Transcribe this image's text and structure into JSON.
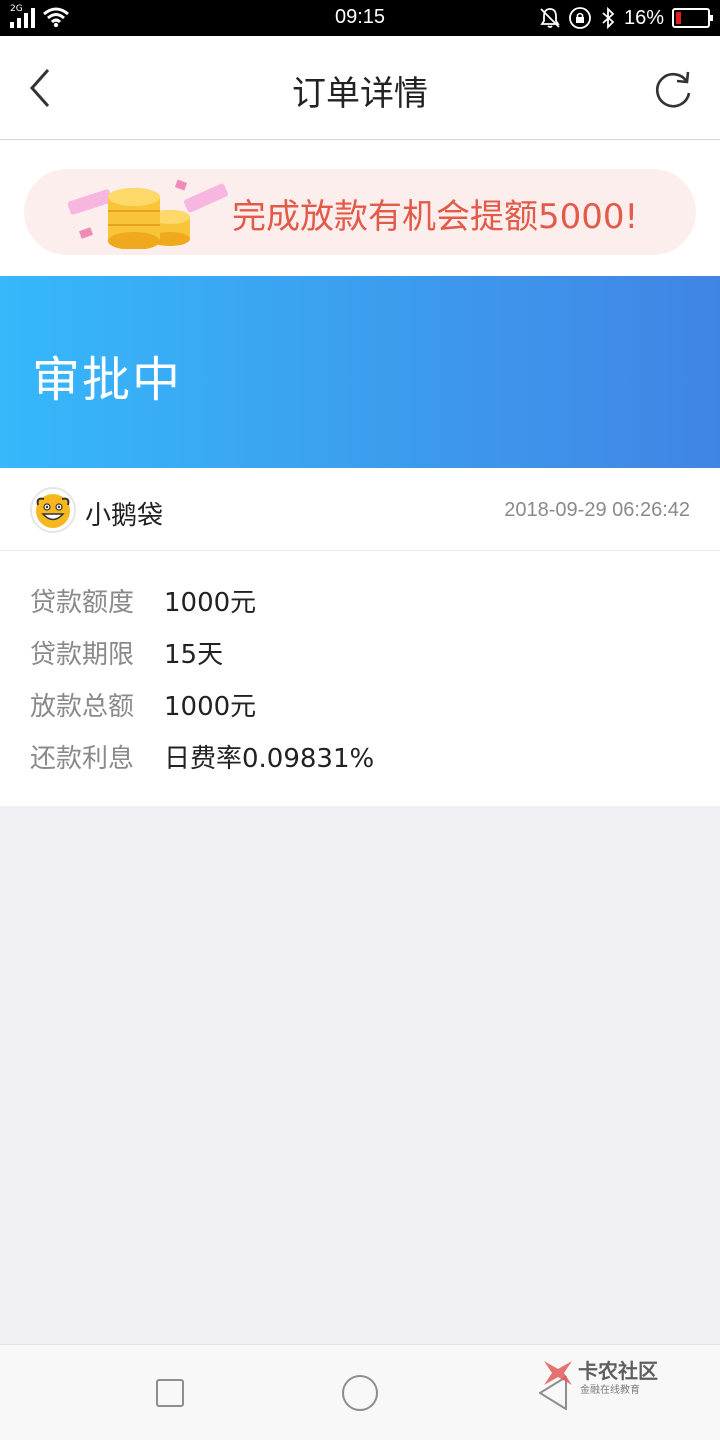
{
  "status_bar": {
    "network": "2G",
    "time": "09:15",
    "battery_percent": "16%",
    "battery_level": 0.16,
    "icons": [
      "signal-icon",
      "wifi-icon",
      "mute-bell-icon",
      "rotation-lock-icon",
      "bluetooth-icon",
      "battery-icon"
    ]
  },
  "header": {
    "title": "订单详情",
    "back_icon": "chevron-left-icon",
    "refresh_icon": "refresh-icon"
  },
  "promo": {
    "text": "完成放款有机会提额5000!",
    "text_color": "#e25a48",
    "background": "#fdeeee"
  },
  "status_banner": {
    "status": "审批中",
    "gradient_start": "#36b8fb",
    "gradient_end": "#4185e4"
  },
  "order": {
    "lender_name": "小鹅袋",
    "created_at": "2018-09-29 06:26:42",
    "details": [
      {
        "label": "贷款额度",
        "value": "1000元"
      },
      {
        "label": "贷款期限",
        "value": "15天"
      },
      {
        "label": "放款总额",
        "value": "1000元"
      },
      {
        "label": "还款利息",
        "value": "日费率0.09831%"
      }
    ]
  },
  "watermark": {
    "main": "卡农社区",
    "sub": "金融在线教育"
  },
  "navbar": {
    "icons": [
      "recent-apps-icon",
      "home-icon",
      "back-triangle-icon"
    ]
  }
}
